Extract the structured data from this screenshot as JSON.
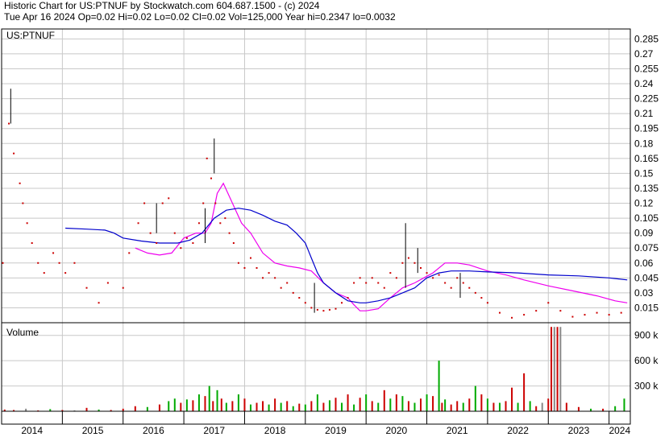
{
  "header": {
    "line1": "Historic Chart for US:PTNUF by Stockwatch.com 604.687.1500 - (c) 2024",
    "line2": "Tue Apr 16 2024  Op=0.02  Hi=0.02  Lo=0.02  Cl=0.02  Vol=125,000  Year hi=0.2347  lo=0.0032"
  },
  "chart_data": [
    {
      "type": "line",
      "title": "US:PTNUF",
      "price_ylim": [
        0.0,
        0.295
      ],
      "y_ticks": [
        0.015,
        0.03,
        0.045,
        0.06,
        0.075,
        0.09,
        0.105,
        0.12,
        0.135,
        0.15,
        0.165,
        0.18,
        0.195,
        0.21,
        0.225,
        0.24,
        0.255,
        0.27,
        0.285
      ],
      "y_tick_labels": [
        "0.015",
        "0.03",
        "0.045",
        "0.06",
        "0.075",
        "0.09",
        "0.105",
        "0.12",
        "0.135",
        "0.15",
        "0.165",
        "0.18",
        "0.195",
        "0.21",
        "0.225",
        "0.24",
        "0.255",
        "0.27",
        "0.285"
      ],
      "x_range": [
        2014.0,
        2024.35
      ],
      "x_labels": [
        "2014",
        "2015",
        "2016",
        "2017",
        "2018",
        "2019",
        "2020",
        "2021",
        "2022",
        "2023",
        "2024"
      ],
      "grid": true,
      "colors": {
        "price": "#cc0000",
        "ma_short": "#ee00ee",
        "ma_long": "#0000cc",
        "grid": "#c8c8c8"
      },
      "price_points": {
        "x": [
          2014.02,
          2014.12,
          2014.2,
          2014.3,
          2014.35,
          2014.42,
          2014.5,
          2014.6,
          2014.7,
          2014.85,
          2014.95,
          2015.05,
          2015.2,
          2015.4,
          2015.6,
          2015.75,
          2016.0,
          2016.1,
          2016.25,
          2016.35,
          2016.45,
          2016.55,
          2016.65,
          2016.75,
          2016.85,
          2016.95,
          2017.05,
          2017.15,
          2017.25,
          2017.32,
          2017.38,
          2017.45,
          2017.52,
          2017.6,
          2017.68,
          2017.75,
          2017.82,
          2017.9,
          2018.0,
          2018.1,
          2018.2,
          2018.3,
          2018.4,
          2018.5,
          2018.6,
          2018.7,
          2018.8,
          2018.9,
          2019.0,
          2019.1,
          2019.2,
          2019.3,
          2019.4,
          2019.5,
          2019.6,
          2019.7,
          2019.8,
          2019.9,
          2020.0,
          2020.1,
          2020.2,
          2020.3,
          2020.4,
          2020.5,
          2020.6,
          2020.7,
          2020.8,
          2020.9,
          2021.0,
          2021.1,
          2021.2,
          2021.3,
          2021.4,
          2021.5,
          2021.6,
          2021.7,
          2021.8,
          2021.9,
          2022.0,
          2022.2,
          2022.4,
          2022.6,
          2022.8,
          2023.0,
          2023.2,
          2023.4,
          2023.6,
          2023.8,
          2024.0,
          2024.2
        ],
        "y": [
          0.06,
          0.2,
          0.17,
          0.14,
          0.12,
          0.1,
          0.08,
          0.06,
          0.05,
          0.07,
          0.06,
          0.05,
          0.06,
          0.035,
          0.02,
          0.04,
          0.035,
          0.07,
          0.1,
          0.12,
          0.09,
          0.08,
          0.12,
          0.125,
          0.09,
          0.075,
          0.085,
          0.08,
          0.1,
          0.12,
          0.165,
          0.145,
          0.12,
          0.1,
          0.105,
          0.09,
          0.08,
          0.06,
          0.055,
          0.065,
          0.055,
          0.045,
          0.05,
          0.045,
          0.035,
          0.04,
          0.03,
          0.025,
          0.02,
          0.015,
          0.013,
          0.012,
          0.013,
          0.014,
          0.02,
          0.025,
          0.04,
          0.045,
          0.04,
          0.045,
          0.04,
          0.035,
          0.05,
          0.045,
          0.06,
          0.065,
          0.06,
          0.055,
          0.05,
          0.045,
          0.048,
          0.04,
          0.035,
          0.045,
          0.04,
          0.035,
          0.03,
          0.025,
          0.02,
          0.01,
          0.005,
          0.008,
          0.012,
          0.02,
          0.012,
          0.006,
          0.008,
          0.01,
          0.008,
          0.01
        ]
      },
      "spikes": [
        {
          "x": 2014.15,
          "lo": 0.2,
          "hi": 0.235
        },
        {
          "x": 2016.55,
          "lo": 0.09,
          "hi": 0.12
        },
        {
          "x": 2017.35,
          "lo": 0.08,
          "hi": 0.115
        },
        {
          "x": 2017.5,
          "lo": 0.15,
          "hi": 0.185
        },
        {
          "x": 2019.15,
          "lo": 0.01,
          "hi": 0.04
        },
        {
          "x": 2020.65,
          "lo": 0.035,
          "hi": 0.1
        },
        {
          "x": 2020.85,
          "lo": 0.05,
          "hi": 0.075
        },
        {
          "x": 2021.55,
          "lo": 0.025,
          "hi": 0.05
        }
      ],
      "series": [
        {
          "x": [
            2016.2,
            2016.4,
            2016.6,
            2016.8,
            2017.0,
            2017.2,
            2017.35,
            2017.45,
            2017.55,
            2017.65,
            2017.8,
            2017.95,
            2018.1,
            2018.3,
            2018.5,
            2018.7,
            2018.9,
            2019.1,
            2019.3,
            2019.5,
            2019.7,
            2019.8,
            2019.9,
            2020.0,
            2020.2,
            2020.4,
            2020.6,
            2020.8,
            2020.95,
            2021.1,
            2021.3,
            2021.5,
            2021.7,
            2022.0,
            2022.3,
            2022.6,
            2023.0,
            2023.4,
            2023.8,
            2024.1,
            2024.3
          ],
          "y": [
            0.075,
            0.07,
            0.068,
            0.07,
            0.085,
            0.09,
            0.09,
            0.1,
            0.13,
            0.14,
            0.12,
            0.1,
            0.09,
            0.07,
            0.06,
            0.057,
            0.055,
            0.052,
            0.04,
            0.03,
            0.025,
            0.018,
            0.012,
            0.012,
            0.014,
            0.025,
            0.035,
            0.04,
            0.045,
            0.05,
            0.06,
            0.06,
            0.058,
            0.052,
            0.048,
            0.043,
            0.037,
            0.032,
            0.027,
            0.022,
            0.02
          ]
        },
        {
          "x": [
            2015.05,
            2015.4,
            2015.7,
            2015.85,
            2016.0,
            2016.3,
            2016.6,
            2016.9,
            2017.1,
            2017.3,
            2017.5,
            2017.7,
            2017.9,
            2018.1,
            2018.3,
            2018.5,
            2018.7,
            2018.85,
            2019.0,
            2019.1,
            2019.2,
            2019.3,
            2019.5,
            2019.7,
            2019.9,
            2020.0,
            2020.2,
            2020.4,
            2020.6,
            2020.8,
            2021.0,
            2021.2,
            2021.4,
            2021.7,
            2022.0,
            2022.5,
            2023.0,
            2023.5,
            2024.0,
            2024.3
          ],
          "y": [
            0.095,
            0.094,
            0.093,
            0.09,
            0.085,
            0.082,
            0.08,
            0.08,
            0.083,
            0.09,
            0.105,
            0.113,
            0.115,
            0.113,
            0.108,
            0.102,
            0.098,
            0.09,
            0.08,
            0.065,
            0.05,
            0.04,
            0.03,
            0.022,
            0.02,
            0.02,
            0.022,
            0.025,
            0.03,
            0.035,
            0.045,
            0.05,
            0.052,
            0.052,
            0.051,
            0.05,
            0.048,
            0.047,
            0.045,
            0.043
          ]
        }
      ]
    },
    {
      "type": "bar",
      "title": "Volume",
      "ylim": [
        0,
        1050000
      ],
      "y_ticks": [
        300000,
        600000,
        900000
      ],
      "y_tick_labels": [
        "300 k",
        "600 k",
        "900 k"
      ],
      "colors": {
        "up": "#00aa00",
        "down": "#cc0000",
        "flat": "#888888"
      },
      "bars": {
        "x": [
          2014.05,
          2014.2,
          2014.4,
          2014.6,
          2014.8,
          2015.0,
          2015.2,
          2015.4,
          2015.6,
          2015.8,
          2016.0,
          2016.2,
          2016.4,
          2016.6,
          2016.75,
          2016.85,
          2016.95,
          2017.05,
          2017.15,
          2017.25,
          2017.35,
          2017.42,
          2017.48,
          2017.55,
          2017.62,
          2017.7,
          2017.8,
          2017.9,
          2018.0,
          2018.1,
          2018.2,
          2018.3,
          2018.4,
          2018.5,
          2018.6,
          2018.7,
          2018.8,
          2018.9,
          2019.0,
          2019.1,
          2019.2,
          2019.3,
          2019.4,
          2019.5,
          2019.6,
          2019.7,
          2019.8,
          2019.9,
          2020.0,
          2020.1,
          2020.2,
          2020.3,
          2020.4,
          2020.5,
          2020.6,
          2020.7,
          2020.8,
          2020.9,
          2021.0,
          2021.1,
          2021.2,
          2021.25,
          2021.3,
          2021.4,
          2021.5,
          2021.6,
          2021.7,
          2021.8,
          2021.9,
          2022.0,
          2022.1,
          2022.2,
          2022.3,
          2022.4,
          2022.5,
          2022.6,
          2022.7,
          2022.8,
          2022.9,
          2023.0,
          2023.05,
          2023.1,
          2023.15,
          2023.2,
          2023.3,
          2023.5,
          2023.7,
          2023.9,
          2024.1,
          2024.25
        ],
        "v": [
          20000,
          15000,
          30000,
          10000,
          25000,
          15000,
          10000,
          40000,
          20000,
          15000,
          30000,
          60000,
          50000,
          80000,
          120000,
          150000,
          100000,
          140000,
          130000,
          200000,
          180000,
          300000,
          120000,
          250000,
          150000,
          100000,
          120000,
          200000,
          150000,
          80000,
          100000,
          120000,
          80000,
          150000,
          100000,
          120000,
          60000,
          90000,
          80000,
          120000,
          200000,
          100000,
          130000,
          160000,
          100000,
          200000,
          80000,
          160000,
          200000,
          120000,
          100000,
          250000,
          150000,
          200000,
          180000,
          120000,
          100000,
          150000,
          200000,
          180000,
          600000,
          100000,
          140000,
          80000,
          120000,
          100000,
          150000,
          300000,
          200000,
          150000,
          100000,
          100000,
          120000,
          280000,
          100000,
          450000,
          120000,
          60000,
          100000,
          150000,
          1000000,
          1000000,
          1000000,
          1000000,
          100000,
          50000,
          30000,
          30000,
          60000,
          150000
        ],
        "dir": [
          "down",
          "down",
          "flat",
          "down",
          "up",
          "down",
          "flat",
          "down",
          "up",
          "down",
          "down",
          "down",
          "up",
          "down",
          "up",
          "up",
          "down",
          "up",
          "down",
          "up",
          "down",
          "up",
          "down",
          "up",
          "down",
          "up",
          "down",
          "up",
          "down",
          "up",
          "down",
          "down",
          "up",
          "down",
          "up",
          "down",
          "up",
          "down",
          "up",
          "down",
          "up",
          "down",
          "up",
          "down",
          "up",
          "down",
          "up",
          "down",
          "up",
          "down",
          "up",
          "down",
          "up",
          "down",
          "up",
          "down",
          "up",
          "down",
          "up",
          "down",
          "up",
          "down",
          "up",
          "down",
          "down",
          "up",
          "down",
          "up",
          "down",
          "up",
          "down",
          "up",
          "down",
          "down",
          "up",
          "down",
          "up",
          "down",
          "flat",
          "down",
          "down",
          "flat",
          "down",
          "flat",
          "down",
          "down",
          "up",
          "down",
          "up",
          "up"
        ]
      }
    }
  ]
}
